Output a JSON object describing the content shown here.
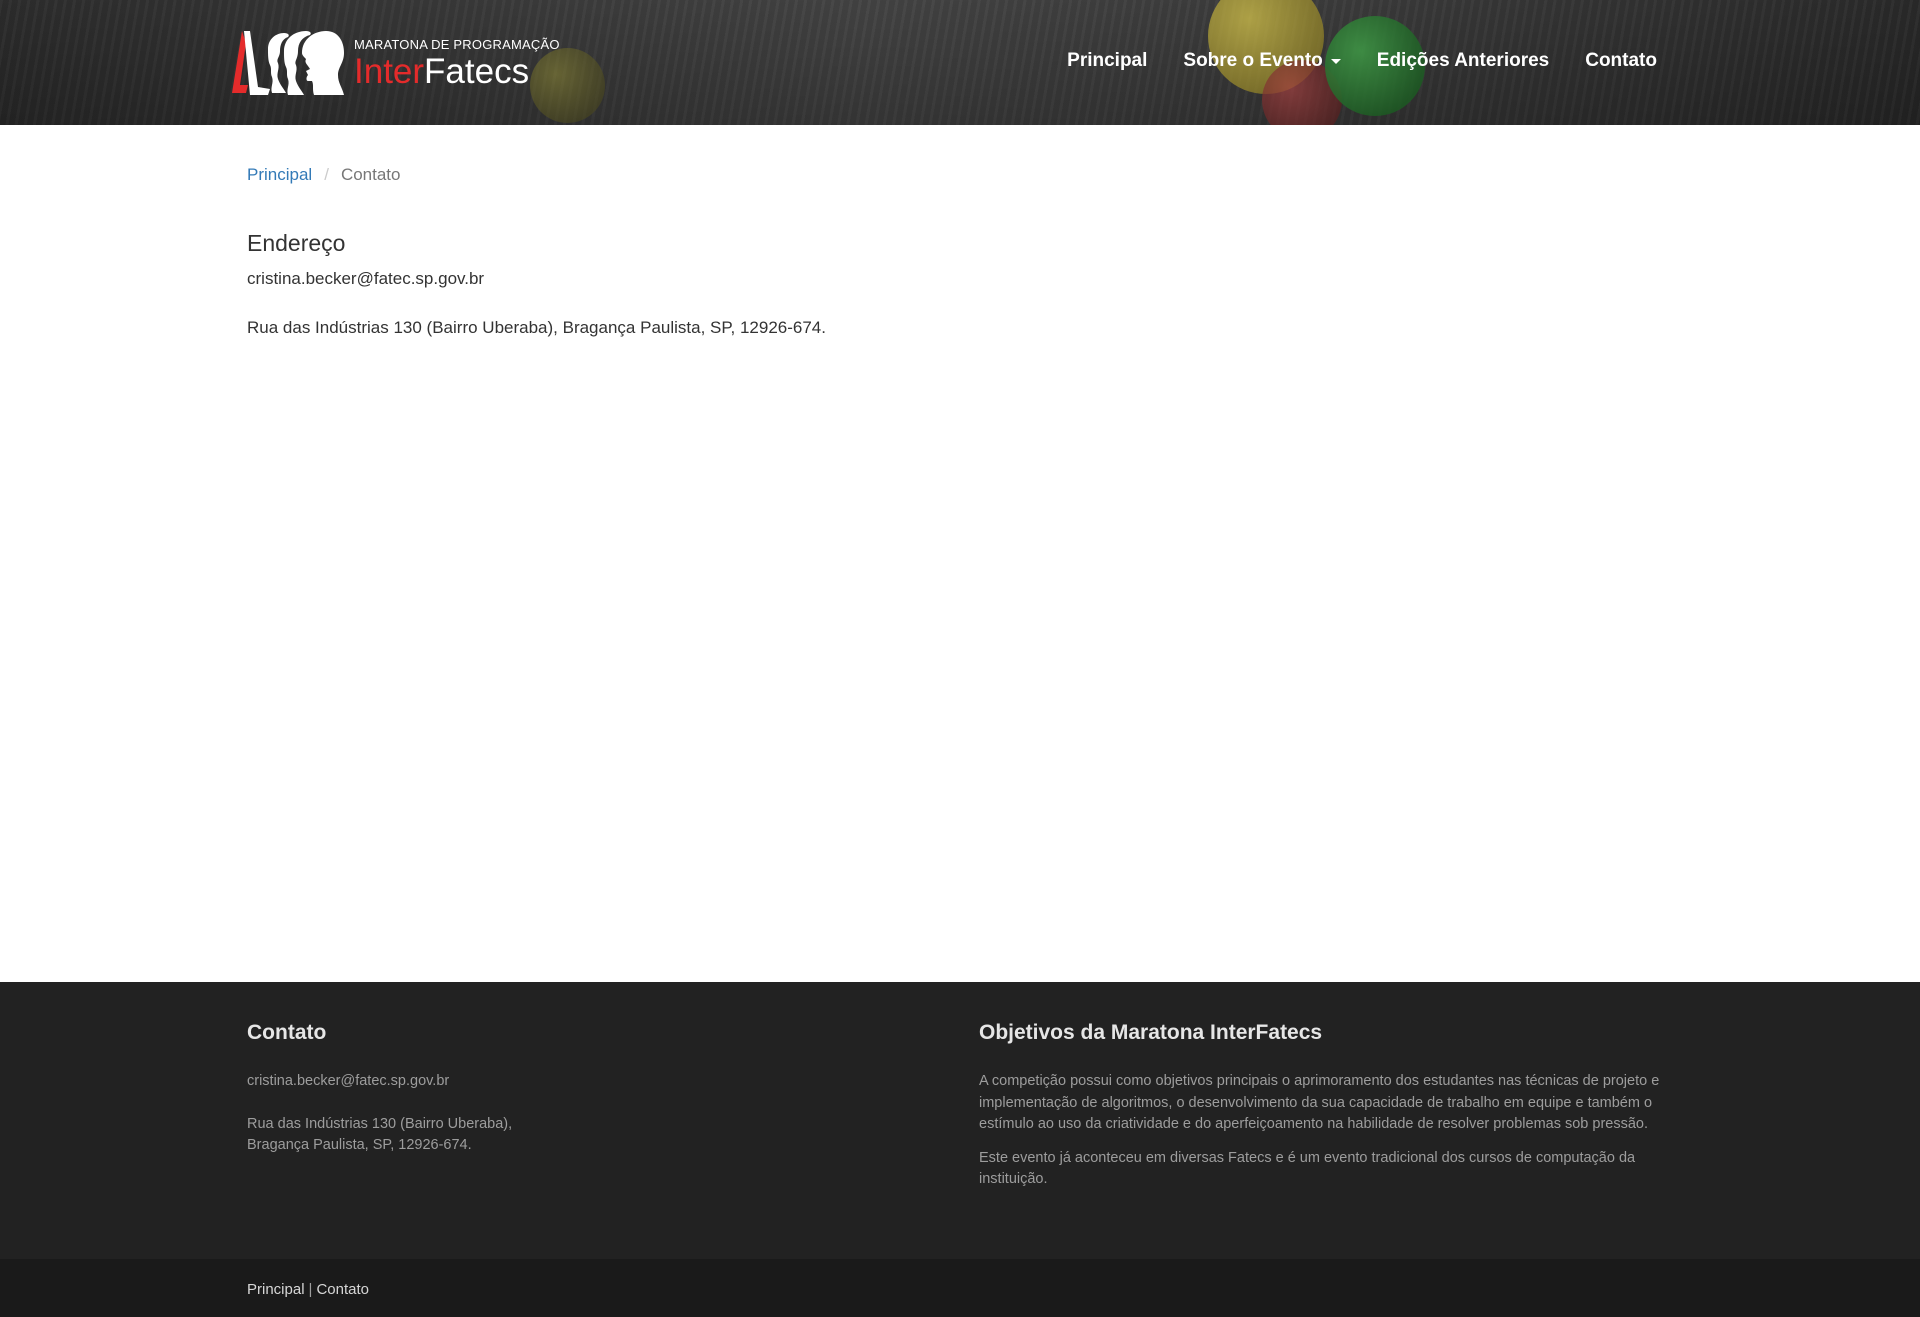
{
  "header": {
    "logo": {
      "small_text": "MARATONA DE PROGRAMAÇÃO",
      "inter": "Inter",
      "fatecs": "Fatecs",
      "icon": "profile-heads-logo-icon"
    },
    "nav": [
      {
        "label": "Principal"
      },
      {
        "label": "Sobre o Evento",
        "has_dropdown": true
      },
      {
        "label": "Edições Anteriores"
      },
      {
        "label": "Contato"
      }
    ],
    "dropdown_icon": "caret-down-icon"
  },
  "breadcrumb": {
    "home": "Principal",
    "separator": "/",
    "current": "Contato"
  },
  "main": {
    "title": "Endereço",
    "email": "cristina.becker@fatec.sp.gov.br",
    "address": "Rua das Indústrias 130 (Bairro Uberaba), Bragança Paulista, SP, 12926-674."
  },
  "footer": {
    "contact": {
      "title": "Contato",
      "email": "cristina.becker@fatec.sp.gov.br",
      "address_line1": "Rua das Indústrias 130 (Bairro Uberaba),",
      "address_line2": "Bragança Paulista, SP, 12926-674."
    },
    "objectives": {
      "title": "Objetivos da Maratona InterFatecs",
      "paragraph1": "A competição possui como objetivos principais o aprimoramento dos estudantes nas técnicas de projeto e implementação de algoritmos, o desenvolvimento da sua capacidade de trabalho em equipe e também o estímulo ao uso da criatividade e do aperfeiçoamento na habilidade de resolver problemas sob pressão.",
      "paragraph2": "Este evento já aconteceu em diversas Fatecs e é um evento tradicional dos cursos de computação da instituição."
    },
    "bottom_links": {
      "home": "Principal",
      "separator": "|",
      "contact": "Contato"
    }
  },
  "colors": {
    "link": "#337ab7",
    "logo_red": "#e42b2b",
    "footer_bg": "#222222",
    "bottom_bg": "#1a1a1a"
  }
}
